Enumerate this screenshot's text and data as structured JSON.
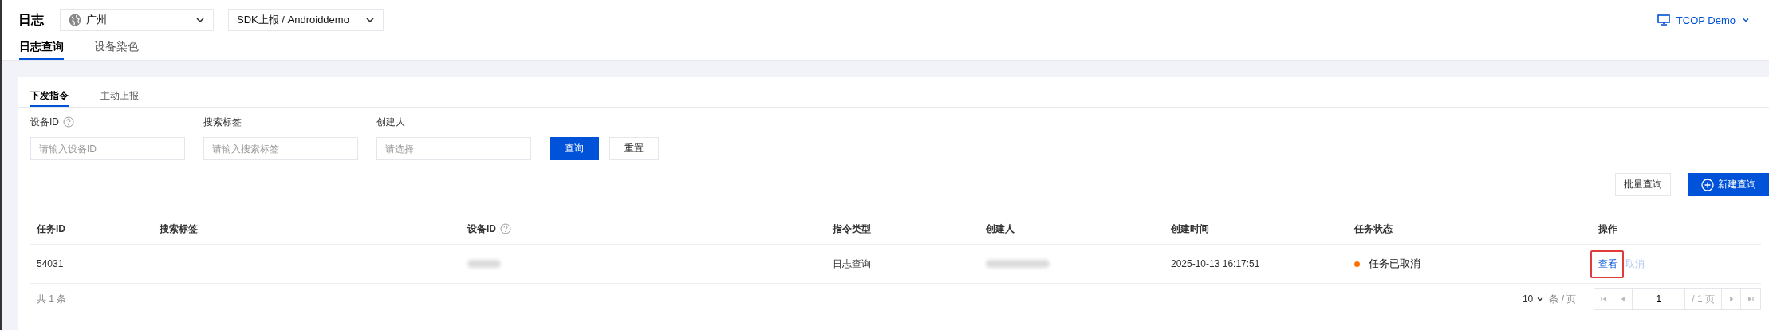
{
  "header": {
    "title": "日志",
    "region_select": {
      "value": "广州"
    },
    "source_select": {
      "value": "SDK上报 / Androiddemo"
    },
    "account": {
      "label": "TCOP Demo"
    }
  },
  "tabs": [
    {
      "label": "日志查询",
      "selected": true
    },
    {
      "label": "设备染色",
      "selected": false
    }
  ],
  "sub_tabs": [
    {
      "label": "下发指令",
      "selected": true
    },
    {
      "label": "主动上报",
      "selected": false
    }
  ],
  "filters": [
    {
      "label": "设备ID",
      "help": true,
      "placeholder": "请输入设备ID"
    },
    {
      "label": "搜索标签",
      "help": false,
      "placeholder": "请输入搜索标签"
    },
    {
      "label": "创建人",
      "help": false,
      "placeholder": "请选择"
    }
  ],
  "filter_buttons": [
    {
      "label": "查询",
      "primary": true
    },
    {
      "label": "重置",
      "primary": false
    }
  ],
  "toolbar_buttons": [
    {
      "label": "批量查询",
      "primary": false,
      "plus": false
    },
    {
      "label": "新建查询",
      "primary": true,
      "plus": true
    }
  ],
  "table": {
    "columns": [
      {
        "label": "任务ID",
        "help": false
      },
      {
        "label": "搜索标签",
        "help": false
      },
      {
        "label": "设备ID",
        "help": true
      },
      {
        "label": "指令类型",
        "help": false
      },
      {
        "label": "创建人",
        "help": false
      },
      {
        "label": "创建时间",
        "help": false
      },
      {
        "label": "任务状态",
        "help": false
      },
      {
        "label": "操作",
        "help": false
      }
    ],
    "rows": [
      {
        "task_id": "54031",
        "device_id_blurred": true,
        "command_type": "日志查询",
        "creator_blurred": true,
        "created_at": "2025-10-13 16:17:51",
        "status": {
          "label": "任务已取消",
          "color": "#ff7200"
        },
        "actions": [
          {
            "label": "查看",
            "disabled": false,
            "highlighted": true
          },
          {
            "label": "取消",
            "disabled": true,
            "highlighted": false
          }
        ]
      }
    ]
  },
  "footer": {
    "total": "共 1 条",
    "page_size": "10",
    "page_size_unit": "条 / 页",
    "page": "1",
    "page_total": "/ 1 页"
  }
}
